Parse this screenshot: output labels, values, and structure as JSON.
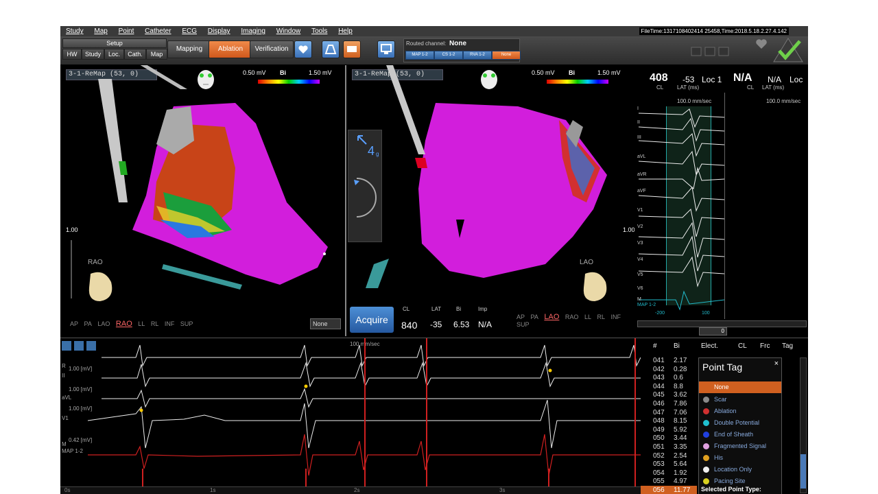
{
  "menu": [
    "Study",
    "Map",
    "Point",
    "Catheter",
    "ECG",
    "Display",
    "Imaging",
    "Window",
    "Tools",
    "Help"
  ],
  "file_info": "FileTime:1317108402414 25458,Time:2018.5.18.2.27.4.142",
  "toolbar": {
    "setup_label": "Setup",
    "setup_buttons": [
      "HW",
      "Study",
      "Loc.",
      "Cath.",
      "Map"
    ],
    "modes": [
      "Mapping",
      "Ablation",
      "Verification"
    ],
    "active_mode": "Ablation",
    "routed_label": "Routed channel:",
    "routed_value": "None",
    "routed_chips": [
      "MAP 1-2",
      "CS 1-2",
      "RVA 1-2",
      "None"
    ]
  },
  "left_map": {
    "map_name": "3-1-ReMap (53, 0)",
    "scale_min": "0.50 mV",
    "scale_type": "Bi",
    "scale_max": "1.50 mV",
    "zoom": "1.00",
    "orientation": "RAO",
    "views": [
      "AP",
      "PA",
      "LAO",
      "RAO",
      "LL",
      "RL",
      "INF",
      "SUP"
    ],
    "current_view": "RAO",
    "dropdown": "None"
  },
  "right_map": {
    "map_name": "3-1-ReMap (53, 0)",
    "scale_min": "0.50 mV",
    "scale_type": "Bi",
    "scale_max": "1.50 mV",
    "zoom": "1.00",
    "orientation": "LAO",
    "views": [
      "AP",
      "PA",
      "LAO",
      "RAO",
      "LL",
      "RL",
      "INF",
      "SUP"
    ],
    "current_view": "LAO",
    "force_value": "4",
    "force_unit": "g",
    "acquire_label": "Acquire",
    "point": {
      "cl_label": "CL",
      "lat_label": "LAT",
      "bi_label": "Bi",
      "imp_label": "Imp",
      "cl": "840",
      "lat": "-35",
      "bi": "6.53",
      "imp": "N/A"
    }
  },
  "ecg_side": {
    "cl_value": "408",
    "cl_label": "CL",
    "lat_value": "-53",
    "lat_label": "LAT (ms)",
    "loc": "Loc 1",
    "cl2_value": "N/A",
    "cl2_label": "CL",
    "lat2_value": "N/A",
    "lat2_label": "LAT (ms)",
    "loc2": "Loc",
    "speed": "100.0 mm/sec",
    "leads": [
      "I",
      "II",
      "III",
      "aVL",
      "aVR",
      "aVF",
      "V1",
      "V2",
      "V3",
      "V4",
      "V5",
      "V6",
      "M",
      "MAP 1-2"
    ],
    "annot_left": "-200",
    "annot_right": "100",
    "scroll_value": "0"
  },
  "bottom_ecg": {
    "speed": "100 mm/sec",
    "labels": [
      {
        "name": "R",
        "scale": "1.00 [mV]"
      },
      {
        "name": "II",
        "scale": ""
      },
      {
        "name": "aVL",
        "scale": "1.00 [mV]"
      },
      {
        "name": "V1",
        "scale": "1.00 [mV]"
      },
      {
        "name": "M",
        "scale": "0.42 [mV]"
      },
      {
        "name": "MAP 1-2",
        "scale": ""
      }
    ],
    "time_ticks": [
      "0s",
      "1s",
      "2s",
      "3s"
    ]
  },
  "point_table": {
    "headers": [
      "#",
      "Bi",
      "Elect.",
      "CL",
      "Frc",
      "Tag"
    ],
    "rows": [
      {
        "id": "041",
        "bi": "2.17"
      },
      {
        "id": "042",
        "bi": "0.28"
      },
      {
        "id": "043",
        "bi": "0.6"
      },
      {
        "id": "044",
        "bi": "8.8"
      },
      {
        "id": "045",
        "bi": "3.62"
      },
      {
        "id": "046",
        "bi": "7.86"
      },
      {
        "id": "047",
        "bi": "7.06"
      },
      {
        "id": "048",
        "bi": "8.15"
      },
      {
        "id": "049",
        "bi": "5.92"
      },
      {
        "id": "050",
        "bi": "3.44"
      },
      {
        "id": "051",
        "bi": "3.35"
      },
      {
        "id": "052",
        "bi": "2.54"
      },
      {
        "id": "053",
        "bi": "5.64"
      },
      {
        "id": "054",
        "bi": "1.92"
      },
      {
        "id": "055",
        "bi": "4.97"
      },
      {
        "id": "056",
        "bi": "11.77"
      }
    ],
    "selected_row": "056"
  },
  "point_tag": {
    "title": "Point Tag",
    "none_label": "None",
    "items": [
      {
        "label": "Scar",
        "color": "#8a8a8a"
      },
      {
        "label": "Ablation",
        "color": "#d03030"
      },
      {
        "label": "Double Potential",
        "color": "#20c0d0"
      },
      {
        "label": "End of Sheath",
        "color": "#2040e0"
      },
      {
        "label": "Fragmented Signal",
        "color": "#e0a0e0"
      },
      {
        "label": "His",
        "color": "#e0a020"
      },
      {
        "label": "Location Only",
        "color": "#f0f0f0"
      },
      {
        "label": "Pacing Site",
        "color": "#d8d020"
      }
    ],
    "selected_type_label": "Selected Point Type:"
  }
}
